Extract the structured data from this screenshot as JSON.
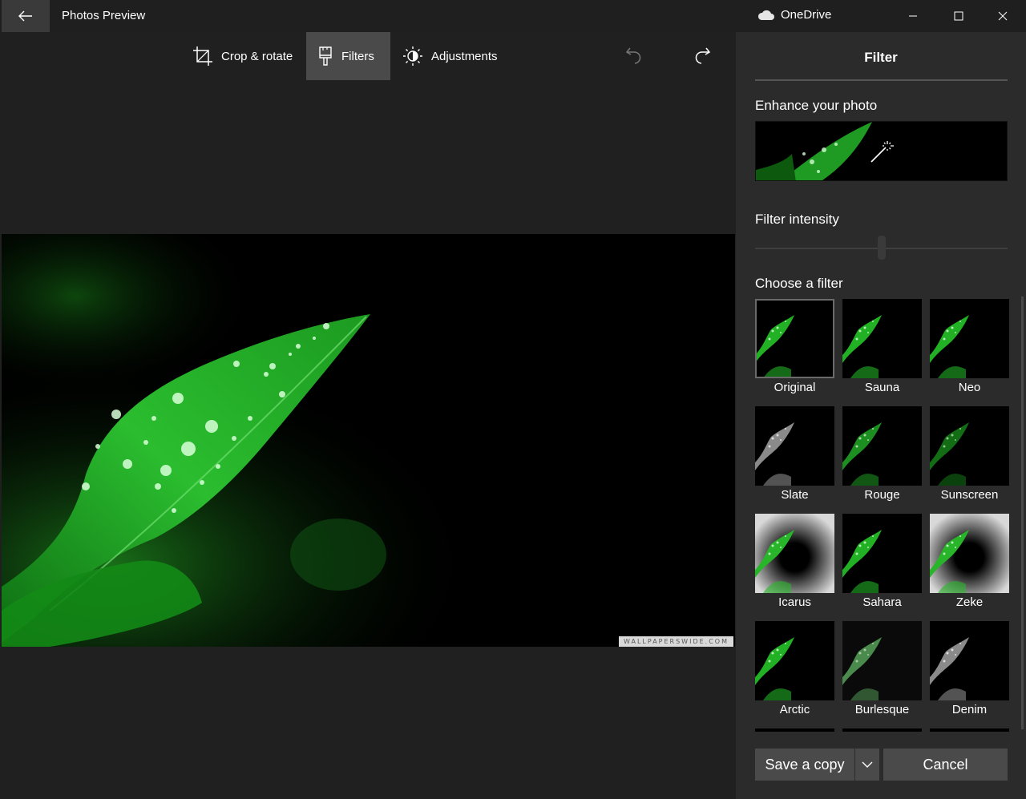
{
  "titlebar": {
    "app_title": "Photos Preview",
    "cloud_label": "OneDrive",
    "icons": [
      "back-arrow-icon",
      "cloud-icon",
      "minimize-icon",
      "maximize-icon",
      "close-icon"
    ]
  },
  "toolbar": {
    "crop_label": "Crop & rotate",
    "filters_label": "Filters",
    "adjustments_label": "Adjustments",
    "active_tool": "Filters",
    "icons": [
      "crop-icon",
      "filter-brush-icon",
      "brightness-icon",
      "undo-icon",
      "redo-icon"
    ]
  },
  "photo": {
    "watermark": "WALLPAPERSWIDE.COM"
  },
  "panel": {
    "title": "Filter",
    "enhance_label": "Enhance your photo",
    "intensity_label": "Filter intensity",
    "intensity_value": 0.5,
    "choose_label": "Choose a filter",
    "selected_filter": "Original",
    "filters": [
      {
        "label": "Original",
        "tone": "green"
      },
      {
        "label": "Sauna",
        "tone": "green"
      },
      {
        "label": "Neo",
        "tone": "green"
      },
      {
        "label": "Slate",
        "tone": "gray"
      },
      {
        "label": "Rouge",
        "tone": "green-muted"
      },
      {
        "label": "Sunscreen",
        "tone": "green-dark"
      },
      {
        "label": "Icarus",
        "tone": "vignette-light"
      },
      {
        "label": "Sahara",
        "tone": "green"
      },
      {
        "label": "Zeke",
        "tone": "vignette-light"
      },
      {
        "label": "Arctic",
        "tone": "green"
      },
      {
        "label": "Burlesque",
        "tone": "green-faded"
      },
      {
        "label": "Denim",
        "tone": "gray"
      }
    ],
    "save_label": "Save a copy",
    "cancel_label": "Cancel"
  },
  "colors": {
    "background": "#202020",
    "panel": "#2b2b2b",
    "button": "#4a4a4a",
    "leaf_green": "#2ecc40"
  }
}
